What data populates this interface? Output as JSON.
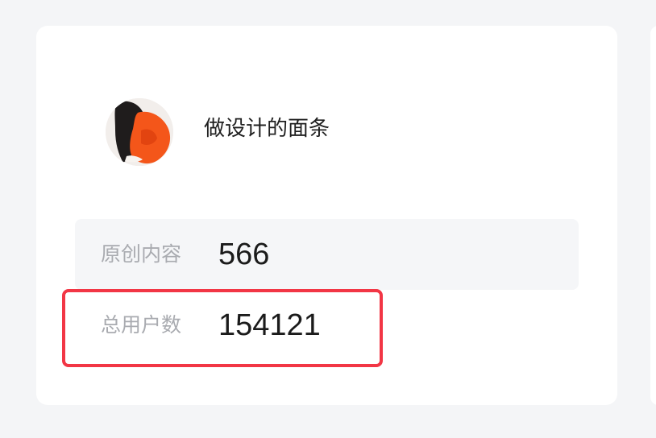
{
  "profile": {
    "name": "做设计的面条"
  },
  "stats": [
    {
      "label": "原创内容",
      "value": "566"
    },
    {
      "label": "总用户数",
      "value": "154121"
    }
  ],
  "colors": {
    "background": "#f4f5f7",
    "card": "#ffffff",
    "stat_row_shade": "#f5f6f8",
    "label": "#a9abb0",
    "value": "#1b1b1b",
    "highlight": "#f23645"
  }
}
